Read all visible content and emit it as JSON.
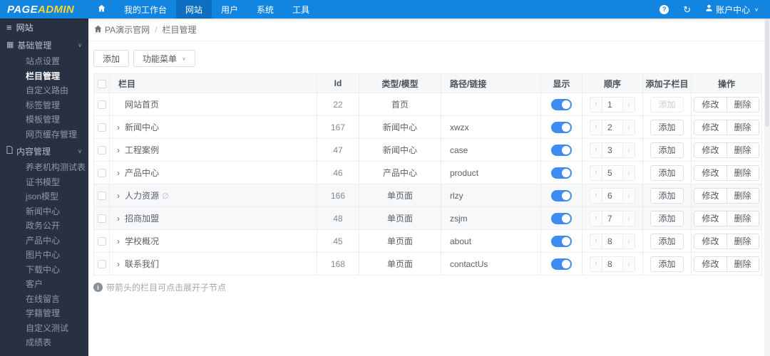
{
  "colors": {
    "topbar_bg": "#1285e0",
    "topbar_active_bg": "#0d6ec2",
    "logo_accent": "#ffd32a",
    "sidebar_bg": "#273142",
    "toggle_on": "#3d8cf2"
  },
  "glyphs": {
    "hamburger": "≡",
    "grid": "▦",
    "chevron_down": "∨",
    "caret_down": "∨",
    "expand_arrow": "›",
    "order_up": "↑",
    "order_down": "↓",
    "hidden": "∅",
    "refresh": "↻",
    "help": "?",
    "info": "i"
  },
  "topbar": {
    "logo_part1": "PAGE",
    "logo_part2": "ADMIN",
    "nav": [
      {
        "label": "我的工作台"
      },
      {
        "label": "网站",
        "active": true
      },
      {
        "label": "用户"
      },
      {
        "label": "系统"
      },
      {
        "label": "工具"
      }
    ],
    "account_label": "账户中心"
  },
  "sidebar": {
    "title": "网站",
    "sections": [
      {
        "label": "基础管理",
        "items": [
          {
            "label": "站点设置"
          },
          {
            "label": "栏目管理",
            "active": true
          },
          {
            "label": "自定义路由"
          },
          {
            "label": "标签管理"
          },
          {
            "label": "模板管理"
          },
          {
            "label": "网页缓存管理"
          }
        ]
      },
      {
        "label": "内容管理",
        "items": [
          {
            "label": "养老机构测试表"
          },
          {
            "label": "证书模型"
          },
          {
            "label": "json模型"
          },
          {
            "label": "新闻中心"
          },
          {
            "label": "政务公开"
          },
          {
            "label": "产品中心"
          },
          {
            "label": "图片中心"
          },
          {
            "label": "下载中心"
          },
          {
            "label": "客户"
          },
          {
            "label": "在线留言"
          },
          {
            "label": "学籍管理"
          },
          {
            "label": "自定义测试"
          },
          {
            "label": "成绩表"
          }
        ]
      }
    ]
  },
  "breadcrumb": {
    "site": "PA演示官网",
    "separator": "/",
    "page": "栏目管理"
  },
  "toolbar": {
    "add_label": "添加",
    "menu_label": "功能菜单"
  },
  "table": {
    "headers": {
      "name": "栏目",
      "id": "Id",
      "type": "类型/模型",
      "path": "路径/链接",
      "visible": "显示",
      "order": "顺序",
      "add_child": "添加子栏目",
      "actions": "操作"
    },
    "buttons": {
      "add": "添加",
      "modify": "修改",
      "delete": "删除"
    },
    "rows": [
      {
        "name": "网站首页",
        "expandable": false,
        "hidden": false,
        "id": "22",
        "type": "首页",
        "path": "",
        "order": "1",
        "add_disabled": true,
        "shaded": false
      },
      {
        "name": "新闻中心",
        "expandable": true,
        "hidden": false,
        "id": "167",
        "type": "新闻中心",
        "path": "xwzx",
        "order": "2",
        "add_disabled": false,
        "shaded": false
      },
      {
        "name": "工程案例",
        "expandable": true,
        "hidden": false,
        "id": "47",
        "type": "新闻中心",
        "path": "case",
        "order": "3",
        "add_disabled": false,
        "shaded": false
      },
      {
        "name": "产品中心",
        "expandable": true,
        "hidden": false,
        "id": "46",
        "type": "产品中心",
        "path": "product",
        "order": "5",
        "add_disabled": false,
        "shaded": false
      },
      {
        "name": "人力资源",
        "expandable": true,
        "hidden": true,
        "id": "166",
        "type": "单页面",
        "path": "rlzy",
        "order": "6",
        "add_disabled": false,
        "shaded": true
      },
      {
        "name": "招商加盟",
        "expandable": true,
        "hidden": false,
        "id": "48",
        "type": "单页面",
        "path": "zsjm",
        "order": "7",
        "add_disabled": false,
        "shaded": true
      },
      {
        "name": "学校概况",
        "expandable": true,
        "hidden": false,
        "id": "45",
        "type": "单页面",
        "path": "about",
        "order": "8",
        "add_disabled": false,
        "shaded": false
      },
      {
        "name": "联系我们",
        "expandable": true,
        "hidden": false,
        "id": "168",
        "type": "单页面",
        "path": "contactUs",
        "order": "8",
        "add_disabled": false,
        "shaded": false
      }
    ],
    "footnote": "带箭头的栏目可点击展开子节点"
  }
}
